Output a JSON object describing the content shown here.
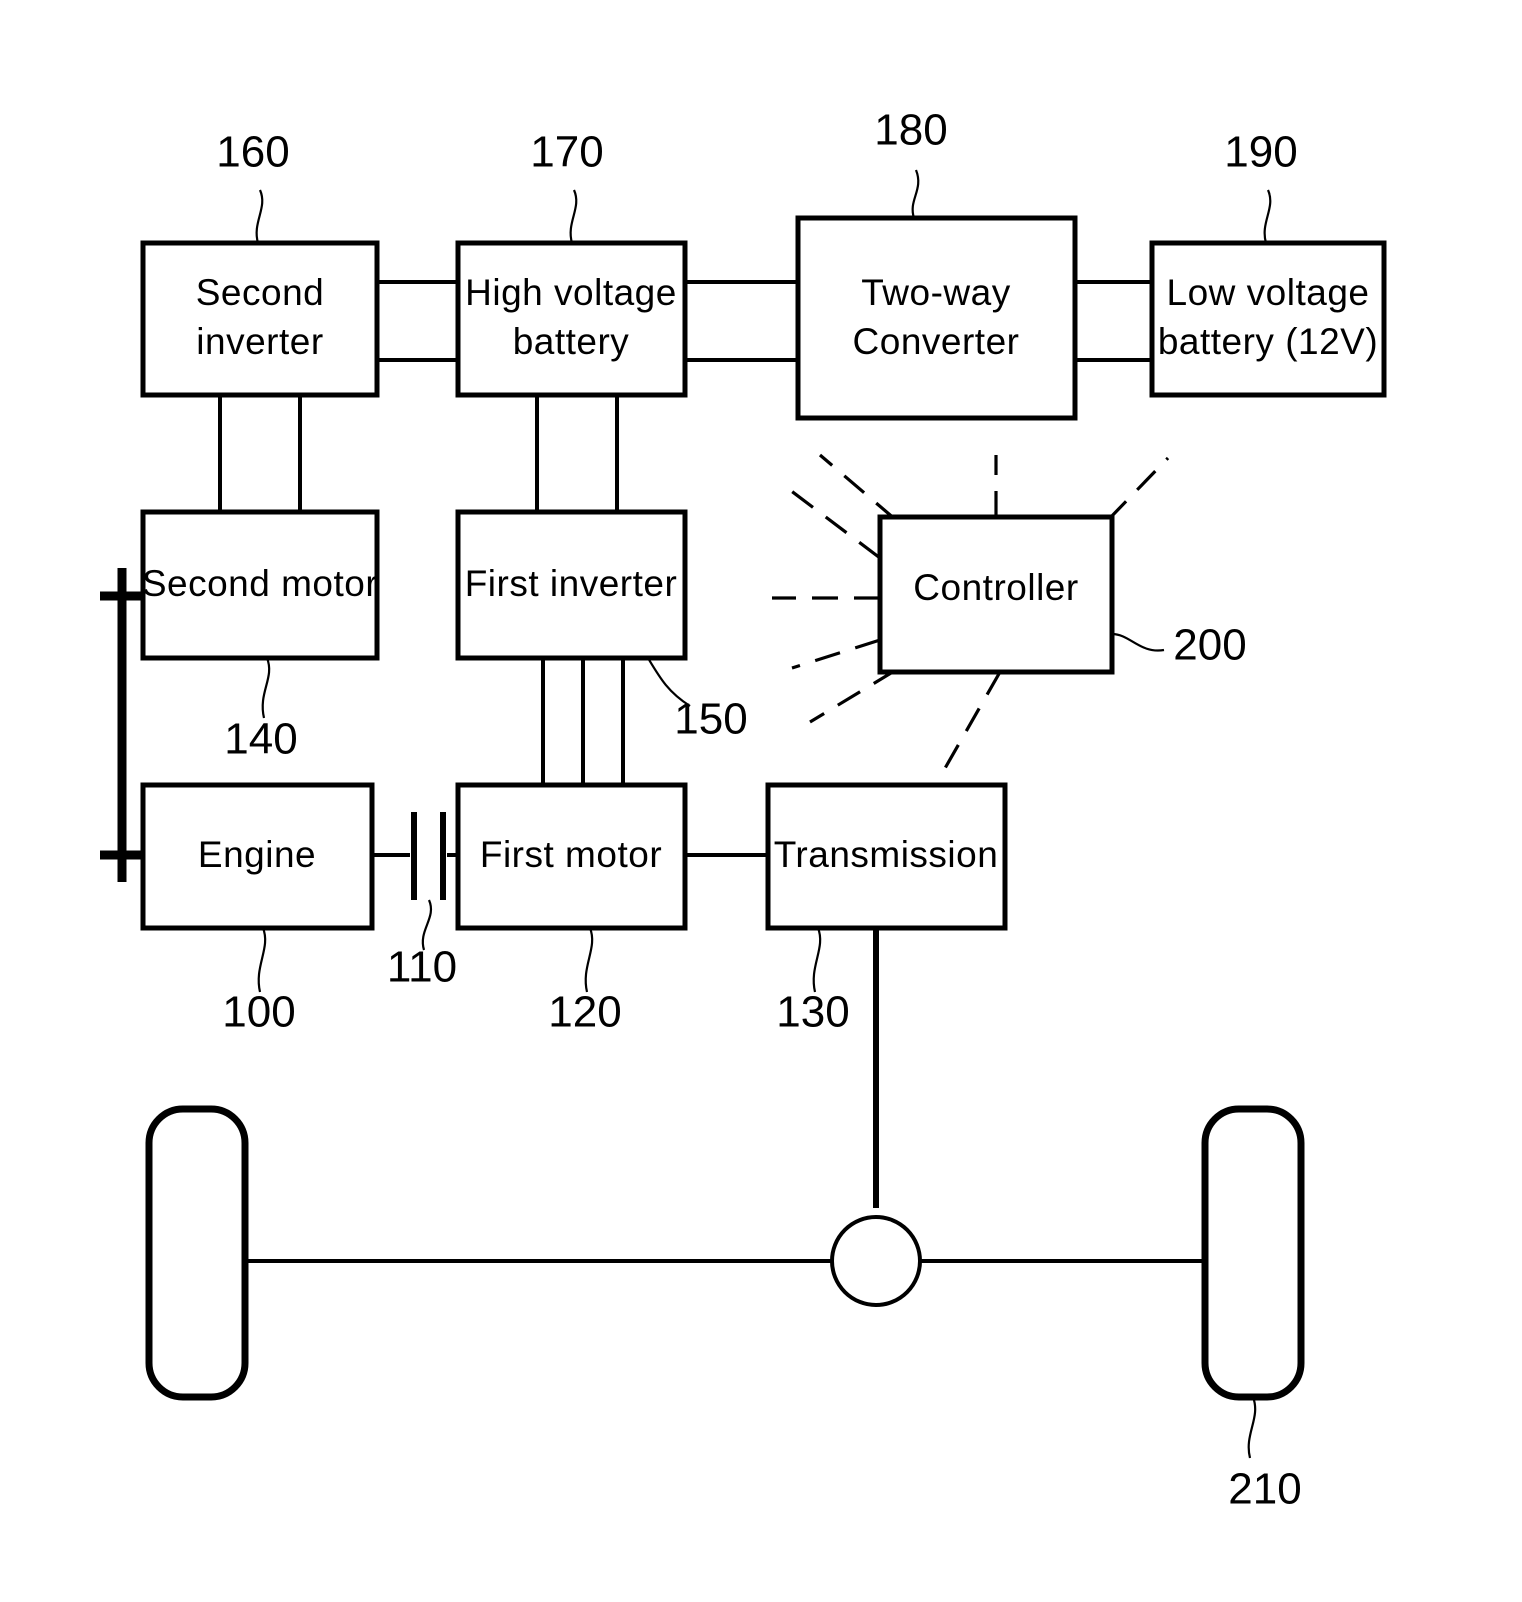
{
  "figure": {
    "type": "patent-block-diagram",
    "subject": "Hybrid vehicle powertrain architecture",
    "blocks": [
      {
        "id": "second_inverter",
        "label_line1": "Second",
        "label_line2": "inverter",
        "ref": "160"
      },
      {
        "id": "high_voltage_battery",
        "label_line1": "High voltage",
        "label_line2": "battery",
        "ref": "170"
      },
      {
        "id": "two_way_converter",
        "label_line1": "Two-way",
        "label_line2": "Converter",
        "ref": "180"
      },
      {
        "id": "low_voltage_battery",
        "label_line1": "Low voltage",
        "label_line2": "battery (12V)",
        "ref": "190"
      },
      {
        "id": "second_motor",
        "label_line1": "Second motor",
        "label_line2": "",
        "ref": "140"
      },
      {
        "id": "first_inverter",
        "label_line1": "First inverter",
        "label_line2": "",
        "ref": "150"
      },
      {
        "id": "controller",
        "label_line1": "Controller",
        "label_line2": "",
        "ref": "200"
      },
      {
        "id": "engine",
        "label_line1": "Engine",
        "label_line2": "",
        "ref": "100"
      },
      {
        "id": "clutch",
        "label_line1": "",
        "label_line2": "",
        "ref": "110"
      },
      {
        "id": "first_motor",
        "label_line1": "First motor",
        "label_line2": "",
        "ref": "120"
      },
      {
        "id": "transmission",
        "label_line1": "Transmission",
        "label_line2": "",
        "ref": "130"
      },
      {
        "id": "wheel",
        "label_line1": "",
        "label_line2": "",
        "ref": "210"
      }
    ],
    "ref_numbers": {
      "engine": "100",
      "clutch": "110",
      "first_motor": "120",
      "transmission": "130",
      "second_motor": "140",
      "first_inverter": "150",
      "second_inverter": "160",
      "high_voltage_battery": "170",
      "two_way_converter": "180",
      "low_voltage_battery": "190",
      "controller": "200",
      "wheel": "210"
    },
    "labels": {
      "second_inverter_l1": "Second",
      "second_inverter_l2": "inverter",
      "high_voltage_battery_l1": "High voltage",
      "high_voltage_battery_l2": "battery",
      "two_way_converter_l1": "Two-way",
      "two_way_converter_l2": "Converter",
      "low_voltage_battery_l1": "Low voltage",
      "low_voltage_battery_l2": "battery (12V)",
      "second_motor": "Second motor",
      "first_inverter": "First inverter",
      "controller": "Controller",
      "engine": "Engine",
      "first_motor": "First motor",
      "transmission": "Transmission"
    },
    "colors": {
      "line": "#000000",
      "fill": "#ffffff",
      "background": "#ffffff"
    }
  }
}
